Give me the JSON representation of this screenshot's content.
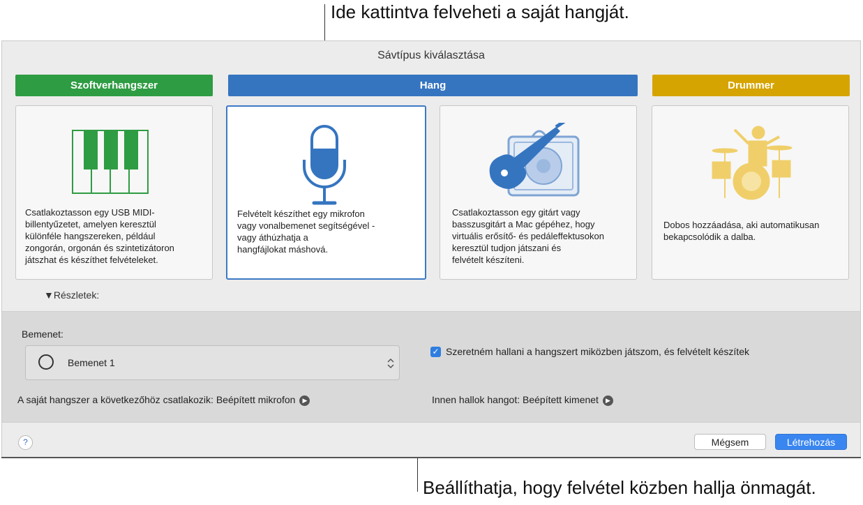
{
  "annotations": {
    "top": "Ide kattintva felveheti a saját hangját.",
    "bottom": "Beállíthatja, hogy felvétel közben hallja önmagát."
  },
  "dialog": {
    "title": "Sávtípus kiválasztása",
    "track_types": [
      {
        "header": "Szoftverhangszer",
        "icon": "piano-keys-icon",
        "color": "#2e9c42",
        "description": [
          "Csatlakoztasson egy USB MIDI-",
          "billentyűzetet, amelyen keresztül",
          "különféle hangszereken, például",
          "zongorán, orgonán és szintetizátoron",
          "játszhat és készíthet felvételeket."
        ]
      },
      {
        "header": "Hang",
        "icon": "microphone-icon",
        "color": "#3575c0",
        "description": [
          "Felvételt készíthet egy mikrofon",
          "vagy vonalbemenet segítségével -",
          "vagy áthúzhatja a",
          "hangfájlokat máshová."
        ]
      },
      {
        "header": "",
        "icon": "guitar-amp-icon",
        "color": "#3575c0",
        "description": [
          "Csatlakoztasson egy gitárt vagy",
          "basszusgitárt a Mac gépéhez, hogy",
          "virtuális erősítő- és pedáleffektusokon",
          "keresztül tudjon játszani és",
          "felvételt készíteni."
        ]
      },
      {
        "header": "Drummer",
        "icon": "drummer-icon",
        "color": "#d6a400",
        "description": [
          "Dobos hozzáadása, aki automatikusan",
          "bekapcsolódik a dalba."
        ]
      }
    ],
    "details_label": "▼Részletek:",
    "details": {
      "input_label": "Bemenet:",
      "input_value": "Bemenet 1",
      "monitor_checkbox_label": "Szeretném hallani a hangszert miközben játszom, és felvételt készítek",
      "monitor_checked": true,
      "instrument_connects": "A saját hangszer a következőhöz csatlakozik: Beépített mikrofon",
      "output_label": "Innen hallok hangot: Beépített kimenet"
    },
    "footer": {
      "help": "?",
      "cancel": "Mégsem",
      "create": "Létrehozás"
    }
  }
}
